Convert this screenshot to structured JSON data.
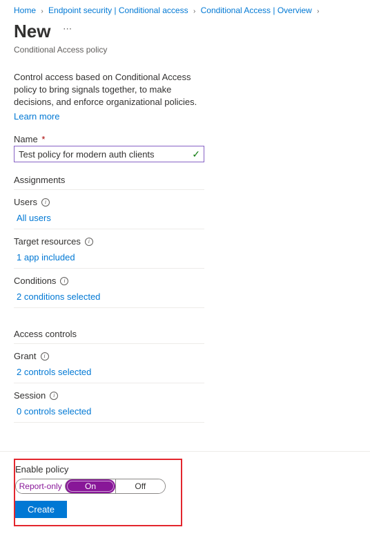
{
  "breadcrumb": {
    "items": [
      {
        "label": "Home"
      },
      {
        "label": "Endpoint security | Conditional access"
      },
      {
        "label": "Conditional Access | Overview"
      }
    ]
  },
  "header": {
    "title": "New",
    "subtitle": "Conditional Access policy"
  },
  "intro": {
    "text": "Control access based on Conditional Access policy to bring signals together, to make decisions, and enforce organizational policies.",
    "learn_more": "Learn more"
  },
  "name_field": {
    "label": "Name",
    "required_marker": "*",
    "value": "Test policy for modern auth clients"
  },
  "assignments": {
    "heading": "Assignments",
    "users": {
      "label": "Users",
      "value": "All users"
    },
    "target": {
      "label": "Target resources",
      "value": "1 app included"
    },
    "conditions": {
      "label": "Conditions",
      "value": "2 conditions selected"
    }
  },
  "access_controls": {
    "heading": "Access controls",
    "grant": {
      "label": "Grant",
      "value": "2 controls selected"
    },
    "session": {
      "label": "Session",
      "value": "0 controls selected"
    }
  },
  "footer": {
    "enable_label": "Enable policy",
    "segments": {
      "report": "Report-only",
      "on": "On",
      "off": "Off"
    },
    "create": "Create"
  }
}
